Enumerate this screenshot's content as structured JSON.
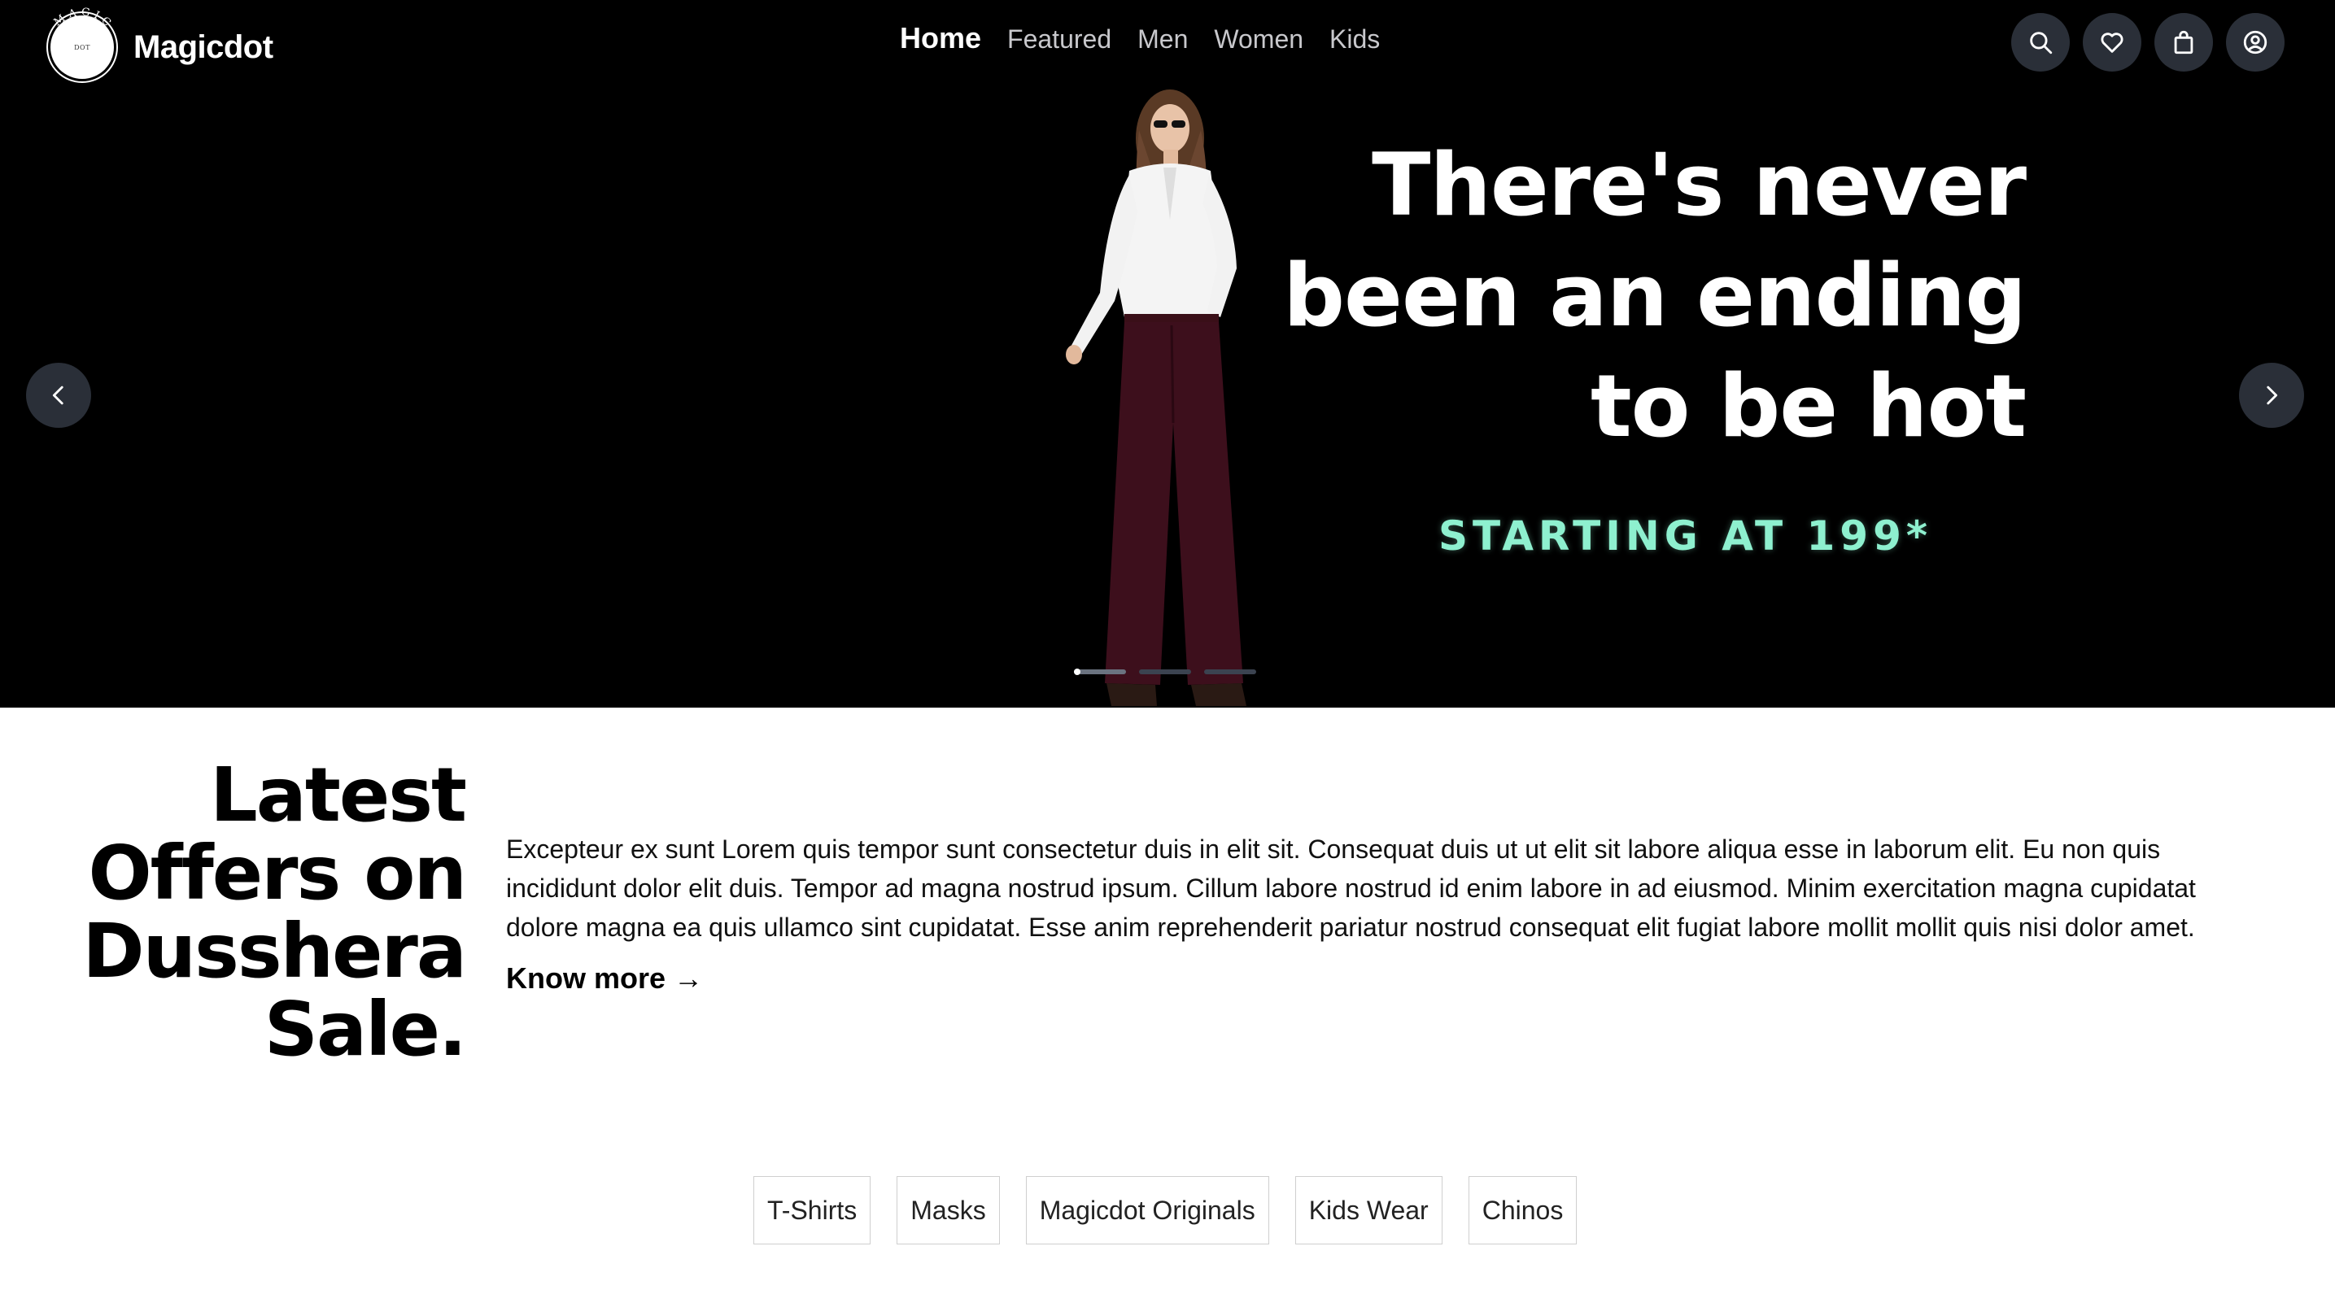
{
  "header": {
    "brand_name": "Magicdot",
    "logo_text": "MAGIC",
    "logo_inner": "DOT",
    "nav": [
      {
        "label": "Home",
        "active": true
      },
      {
        "label": "Featured",
        "active": false
      },
      {
        "label": "Men",
        "active": false
      },
      {
        "label": "Women",
        "active": false
      },
      {
        "label": "Kids",
        "active": false
      }
    ],
    "actions": [
      "search-icon",
      "heart-icon",
      "bag-icon",
      "user-icon"
    ]
  },
  "hero": {
    "headline": "There's never been an ending to be hot",
    "promo": "STARTING AT 199*",
    "slides_count": 3,
    "active_slide": 1,
    "colors": {
      "background": "#000000",
      "promo": "#8ef0cf",
      "button": "#2a2f38"
    }
  },
  "offers": {
    "title": "Latest Offers on Dusshera Sale.",
    "body": "Excepteur ex sunt Lorem quis tempor sunt consectetur duis in elit sit. Consequat duis ut ut elit sit labore aliqua esse in laborum elit. Eu non quis incididunt dolor elit duis. Tempor ad magna nostrud ipsum. Cillum labore nostrud id enim labore in ad eiusmod. Minim exercitation magna cupidatat dolore magna ea quis ullamco sint cupidatat. Esse anim reprehenderit pariatur nostrud consequat elit fugiat labore mollit mollit quis nisi dolor amet.",
    "link_label": "Know more →"
  },
  "categories": [
    "T-Shirts",
    "Masks",
    "Magicdot Originals",
    "Kids Wear",
    "Chinos"
  ]
}
